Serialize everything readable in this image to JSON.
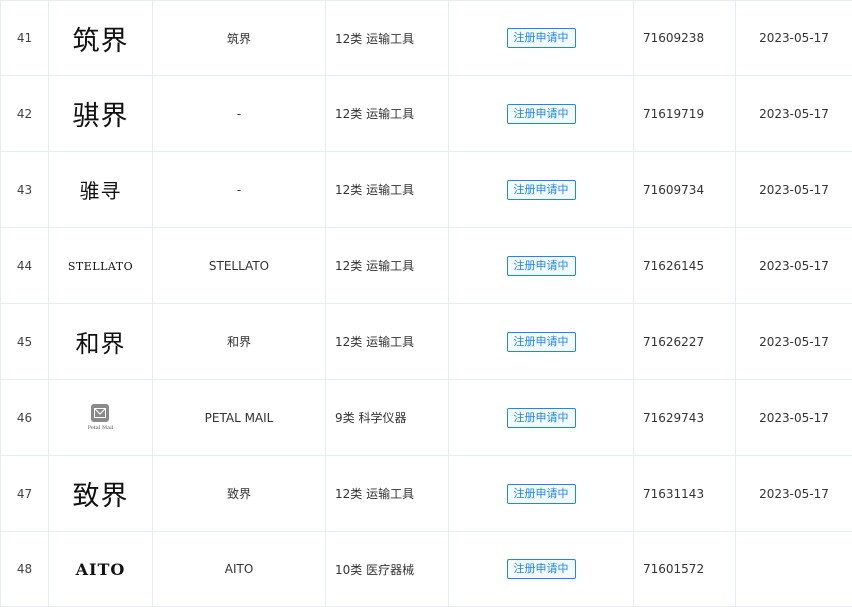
{
  "rows": [
    {
      "index": "41",
      "mark_text": "筑界",
      "name": "筑界",
      "class": "12类 运输工具",
      "status": "注册申请中",
      "reg_no": "71609238",
      "date": "2023-05-17"
    },
    {
      "index": "42",
      "mark_text": "骐界",
      "name": "-",
      "class": "12类 运输工具",
      "status": "注册申请中",
      "reg_no": "71619719",
      "date": "2023-05-17"
    },
    {
      "index": "43",
      "mark_text": "骓寻",
      "name": "-",
      "class": "12类 运输工具",
      "status": "注册申请中",
      "reg_no": "71609734",
      "date": "2023-05-17"
    },
    {
      "index": "44",
      "mark_text": "STELLATO",
      "name": "STELLATO",
      "class": "12类 运输工具",
      "status": "注册申请中",
      "reg_no": "71626145",
      "date": "2023-05-17"
    },
    {
      "index": "45",
      "mark_text": "和界",
      "name": "和界",
      "class": "12类 运输工具",
      "status": "注册申请中",
      "reg_no": "71626227",
      "date": "2023-05-17"
    },
    {
      "index": "46",
      "mark_text": "Petal Mail",
      "name": "PETAL MAIL",
      "class": "9类 科学仪器",
      "status": "注册申请中",
      "reg_no": "71629743",
      "date": "2023-05-17"
    },
    {
      "index": "47",
      "mark_text": "致界",
      "name": "致界",
      "class": "12类 运输工具",
      "status": "注册申请中",
      "reg_no": "71631143",
      "date": "2023-05-17"
    },
    {
      "index": "48",
      "mark_text": "AITO",
      "name": "AITO",
      "class": "10类 医疗器械",
      "status": "注册申请中",
      "reg_no": "71601572",
      "date": ""
    }
  ],
  "icons": {
    "petal_mail_logo": "envelope-icon"
  },
  "colors": {
    "badge": "#1e88e5",
    "border": "#e6eef2"
  }
}
